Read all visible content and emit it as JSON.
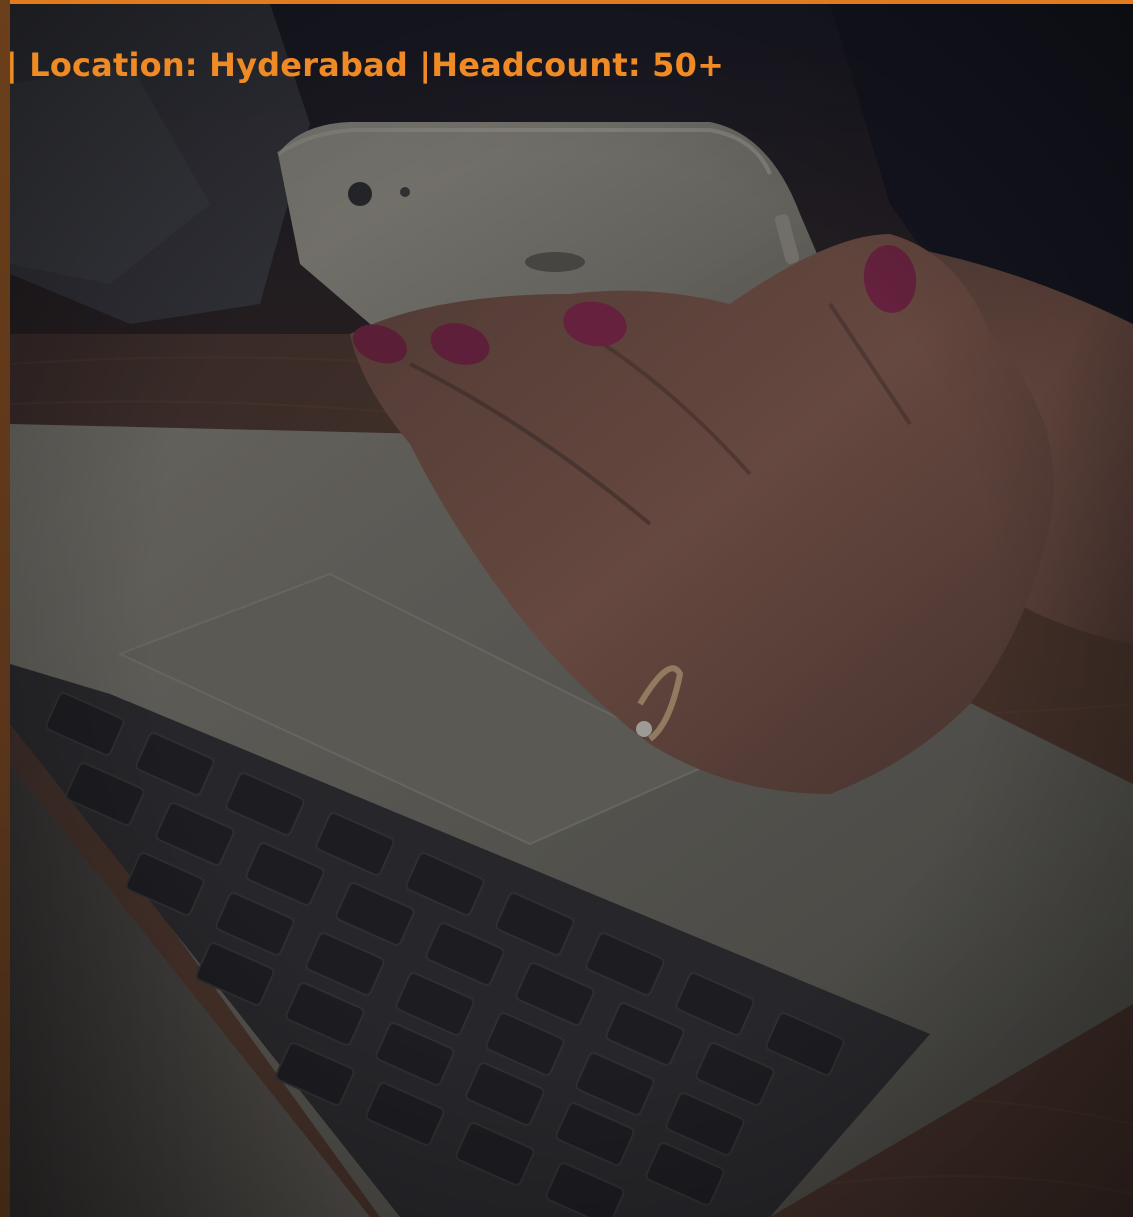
{
  "banner": {
    "pipe_1": "|",
    "location_label": "Location: Hyderabad",
    "pipe_2": "|",
    "headcount_label": "Headcount: 50+"
  },
  "colors": {
    "accent_orange": "#f08a24",
    "border_orange": "#e07b1f",
    "overlay_dark": "#1a1e2e"
  },
  "scene": {
    "subject": "hand holding smartphone over laptop keyboard",
    "icon_names": [
      "smartphone-icon",
      "laptop-icon",
      "keyboard-icon",
      "ring-icon"
    ]
  }
}
